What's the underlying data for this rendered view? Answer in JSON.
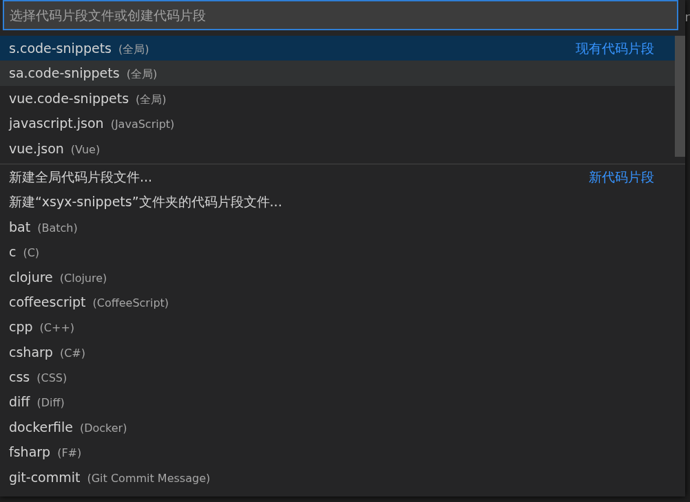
{
  "search": {
    "placeholder": "选择代码片段文件或创建代码片段"
  },
  "background_text": "r",
  "groups": [
    {
      "label": "现有代码片段",
      "items": [
        {
          "name": "s.code-snippets",
          "description": "(全局)",
          "selected": true,
          "hovered": false
        },
        {
          "name": "sa.code-snippets",
          "description": "(全局)",
          "selected": false,
          "hovered": true
        },
        {
          "name": "vue.code-snippets",
          "description": "(全局)",
          "selected": false,
          "hovered": false
        },
        {
          "name": "javascript.json",
          "description": "(JavaScript)",
          "selected": false,
          "hovered": false
        },
        {
          "name": "vue.json",
          "description": "(Vue)",
          "selected": false,
          "hovered": false
        }
      ]
    },
    {
      "label": "新代码片段",
      "items": [
        {
          "name": "新建全局代码片段文件...",
          "selected": false,
          "hovered": false
        },
        {
          "name": "新建“xsyx-snippets”文件夹的代码片段文件...",
          "selected": false,
          "hovered": false
        },
        {
          "name": "bat",
          "description": "(Batch)",
          "selected": false,
          "hovered": false
        },
        {
          "name": "c",
          "description": "(C)",
          "selected": false,
          "hovered": false
        },
        {
          "name": "clojure",
          "description": "(Clojure)",
          "selected": false,
          "hovered": false
        },
        {
          "name": "coffeescript",
          "description": "(CoffeeScript)",
          "selected": false,
          "hovered": false
        },
        {
          "name": "cpp",
          "description": "(C++)",
          "selected": false,
          "hovered": false
        },
        {
          "name": "csharp",
          "description": "(C#)",
          "selected": false,
          "hovered": false
        },
        {
          "name": "css",
          "description": "(CSS)",
          "selected": false,
          "hovered": false
        },
        {
          "name": "diff",
          "description": "(Diff)",
          "selected": false,
          "hovered": false
        },
        {
          "name": "dockerfile",
          "description": "(Docker)",
          "selected": false,
          "hovered": false
        },
        {
          "name": "fsharp",
          "description": "(F#)",
          "selected": false,
          "hovered": false
        },
        {
          "name": "git-commit",
          "description": "(Git Commit Message)",
          "selected": false,
          "hovered": false
        }
      ]
    }
  ]
}
